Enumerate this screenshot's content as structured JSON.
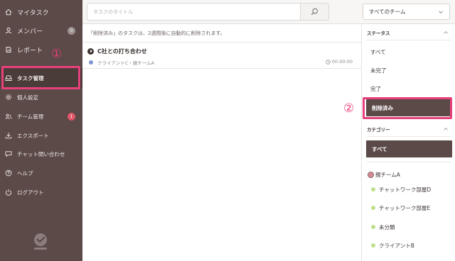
{
  "sidebar": {
    "items": [
      {
        "label": "マイタスク",
        "icon": "home-icon"
      },
      {
        "label": "メンバー",
        "icon": "user-icon",
        "badge": "0"
      },
      {
        "label": "レポート",
        "icon": "report-icon"
      },
      {
        "label": "タスク管理",
        "icon": "inbox-icon"
      },
      {
        "label": "個人設定",
        "icon": "gear-icon"
      },
      {
        "label": "チーム管理",
        "icon": "team-icon",
        "badge": "1"
      },
      {
        "label": "エクスポート",
        "icon": "download-icon"
      },
      {
        "label": "チャット問い合わせ",
        "icon": "chat-icon"
      },
      {
        "label": "ヘルプ",
        "icon": "help-icon"
      },
      {
        "label": "ログアウト",
        "icon": "power-icon"
      }
    ],
    "logo": "app-logo-icon"
  },
  "topbar": {
    "search_placeholder": "タスクのタイトル",
    "search_icon": "magnifier-icon",
    "team_select_value": "すべてのチーム"
  },
  "main": {
    "notice": "「削除済み」のタスクは、2週間後に自動的に削除されます。",
    "tasks": [
      {
        "title": "C社との打ち合わせ",
        "meta": "クライアントC・親チームA",
        "time": "00:00:00",
        "dot_color": "#7d97cf"
      }
    ]
  },
  "filter": {
    "status_header": "ステータス",
    "status_options": [
      "すべて",
      "未完了",
      "完了",
      "削除済み"
    ],
    "status_selected": "削除済み",
    "category_header": "カテゴリー",
    "category_all": "すべて",
    "categories": [
      {
        "label": "親チームA",
        "parent": true
      },
      {
        "label": "チャットワーク部屋D"
      },
      {
        "label": "チャットワーク部屋E"
      },
      {
        "label": "未分類"
      },
      {
        "label": "クライアントB"
      }
    ]
  },
  "annotations": {
    "mark_1": "①",
    "mark_2": "②",
    "color": "#e8407c"
  },
  "colors": {
    "sidebar_bg": "#5b4a47",
    "active_bg": "#5b4a47",
    "accent_pink": "#e8407c",
    "category_dot": "#bfe08a",
    "badge_red": "#e0566a"
  }
}
